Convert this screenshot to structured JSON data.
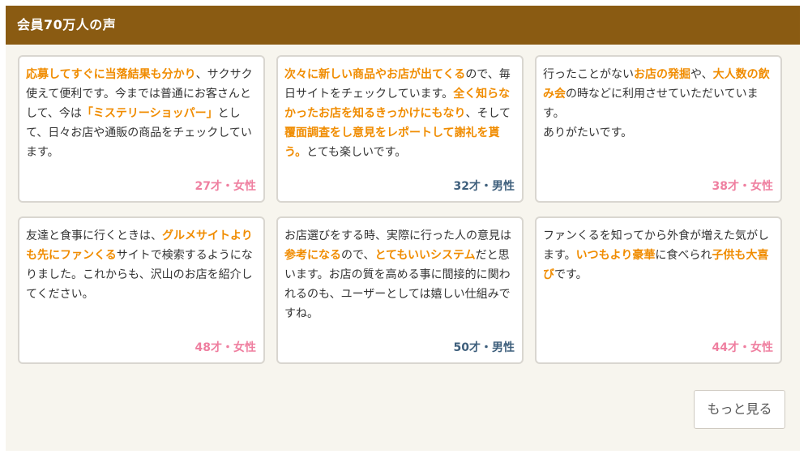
{
  "header": {
    "title": "会員70万人の声"
  },
  "testimonials": [
    {
      "segments": [
        {
          "text": "応募してすぐに当落結果も分かり",
          "hl": true
        },
        {
          "text": "、サクサク使えて便利です。今までは普通にお客さんとして、今は",
          "hl": false
        },
        {
          "text": "「ミステリーショッパー」",
          "hl": true
        },
        {
          "text": "として、日々お店や通販の商品をチェックしています。",
          "hl": false
        }
      ],
      "meta": "27才・女性",
      "gender": "female"
    },
    {
      "segments": [
        {
          "text": "次々に新しい商品やお店が出てくる",
          "hl": true
        },
        {
          "text": "ので、毎日サイトをチェックしています。",
          "hl": false
        },
        {
          "text": "全く知らなかったお店を知るきっかけにもなり",
          "hl": true
        },
        {
          "text": "、そして",
          "hl": false
        },
        {
          "text": "覆面調査をし意見をレポートして謝礼を貰う。",
          "hl": true
        },
        {
          "text": "とても楽しいです。",
          "hl": false
        }
      ],
      "meta": "32才・男性",
      "gender": "male"
    },
    {
      "segments": [
        {
          "text": "行ったことがない",
          "hl": false
        },
        {
          "text": "お店の発掘",
          "hl": true
        },
        {
          "text": "や、",
          "hl": false
        },
        {
          "text": "大人数の飲み会",
          "hl": true
        },
        {
          "text": "の時などに利用させていただいています。\nありがたいです。",
          "hl": false
        }
      ],
      "meta": "38才・女性",
      "gender": "female"
    },
    {
      "segments": [
        {
          "text": "友達と食事に行くときは、",
          "hl": false
        },
        {
          "text": "グルメサイトよりも先にファンくる",
          "hl": true
        },
        {
          "text": "サイトで検索するようになりました。これからも、沢山のお店を紹介してください。",
          "hl": false
        }
      ],
      "meta": "48才・女性",
      "gender": "female"
    },
    {
      "segments": [
        {
          "text": "お店選びをする時、実際に行った人の意見は",
          "hl": false
        },
        {
          "text": "参考になる",
          "hl": true
        },
        {
          "text": "ので、",
          "hl": false
        },
        {
          "text": "とてもいいシステム",
          "hl": true
        },
        {
          "text": "だと思います。お店の質を高める事に間接的に関われるのも、ユーザーとしては嬉しい仕組みですね。",
          "hl": false
        }
      ],
      "meta": "50才・男性",
      "gender": "male"
    },
    {
      "segments": [
        {
          "text": "ファンくるを知ってから外食が増えた気がします。",
          "hl": false
        },
        {
          "text": "いつもより豪華",
          "hl": true
        },
        {
          "text": "に食べられ",
          "hl": false
        },
        {
          "text": "子供も大喜び",
          "hl": true
        },
        {
          "text": "です。",
          "hl": false
        }
      ],
      "meta": "44才・女性",
      "gender": "female"
    }
  ],
  "more_button": {
    "label": "もっと見る"
  },
  "colors": {
    "header_bg": "#8a5b12",
    "highlight": "#f08c00",
    "female": "#ef7fa0",
    "male": "#3e5f7c"
  }
}
